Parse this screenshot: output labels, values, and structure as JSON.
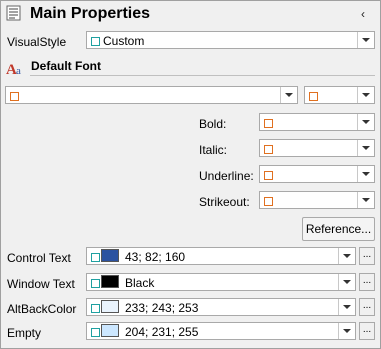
{
  "panel": {
    "title": "Main Properties",
    "collapse_glyph": "‹"
  },
  "visual_style": {
    "label": "VisualStyle",
    "value": "Custom"
  },
  "default_font": {
    "label": "Default Font",
    "font_value": "",
    "size_value": ""
  },
  "font_styles": [
    {
      "label": "Bold:",
      "value": ""
    },
    {
      "label": "Italic:",
      "value": ""
    },
    {
      "label": "Underline:",
      "value": ""
    },
    {
      "label": "Strikeout:",
      "value": ""
    }
  ],
  "reference_button": "Reference...",
  "colors": [
    {
      "label": "Control Text",
      "value": "43; 82; 160",
      "swatch": "#2b52a0"
    },
    {
      "label": "Window Text",
      "value": "Black",
      "swatch": "#000000"
    },
    {
      "label": "AltBackColor",
      "value": "233; 243; 253",
      "swatch": "#e9f3fd"
    },
    {
      "label": "Empty",
      "value": "204; 231; 255",
      "swatch": "#cce7ff"
    }
  ],
  "ellipsis_label": "...",
  "icons": {
    "header": "properties-list-icon",
    "font": "font-aa-icon"
  }
}
